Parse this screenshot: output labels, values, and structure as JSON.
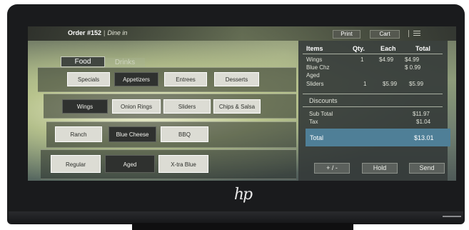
{
  "topbar": {
    "order_label": "Order #152",
    "separator": "|",
    "order_mode": "Dine in",
    "print_label": "Print",
    "cart_label": "Cart",
    "menu_icon": "menu-icon"
  },
  "tabs": [
    {
      "label": "Food",
      "active": true
    },
    {
      "label": "Drinks",
      "active": false
    }
  ],
  "categories": [
    {
      "label": "Specials",
      "selected": false
    },
    {
      "label": "Appetizers",
      "selected": true
    },
    {
      "label": "Entrees",
      "selected": false
    },
    {
      "label": "Desserts",
      "selected": false
    }
  ],
  "items": [
    {
      "label": "Wings",
      "selected": true
    },
    {
      "label": "Onion Rings",
      "selected": false
    },
    {
      "label": "Sliders",
      "selected": false
    },
    {
      "label": "Chips & Salsa",
      "selected": false
    }
  ],
  "sauces": [
    {
      "label": "Ranch",
      "selected": false
    },
    {
      "label": "Blue Cheese",
      "selected": true
    },
    {
      "label": "BBQ",
      "selected": false
    }
  ],
  "styles": [
    {
      "label": "Regular",
      "selected": false
    },
    {
      "label": "Aged",
      "selected": true
    },
    {
      "label": "X-tra Blue",
      "selected": false
    }
  ],
  "ticket": {
    "headers": {
      "items": "Items",
      "qty": "Qty.",
      "each": "Each",
      "total": "Total"
    },
    "lines": [
      {
        "name": "Wings",
        "qty": "1",
        "each": "$4.99",
        "total": "$4.99"
      },
      {
        "name": "Blue Chz",
        "qty": "",
        "each": "",
        "total": "$ 0.99"
      },
      {
        "name": "Aged",
        "qty": "",
        "each": "",
        "total": ""
      },
      {
        "name": "Sliders",
        "qty": "1",
        "each": "$5.99",
        "total": "$5.99"
      }
    ],
    "discounts_label": "Discounts",
    "subtotal_label": "Sub Total",
    "subtotal_value": "$11.97",
    "tax_label": "Tax",
    "tax_value": "$1.04",
    "total_label": "Total",
    "total_value": "$13.01",
    "plusminus_label": "+ / -",
    "hold_label": "Hold",
    "send_label": "Send"
  },
  "device": {
    "logo": "hp"
  },
  "colors": {
    "accent": "#4f7f97",
    "selected_button": "#2f312f",
    "button": "#dcdcd4"
  }
}
